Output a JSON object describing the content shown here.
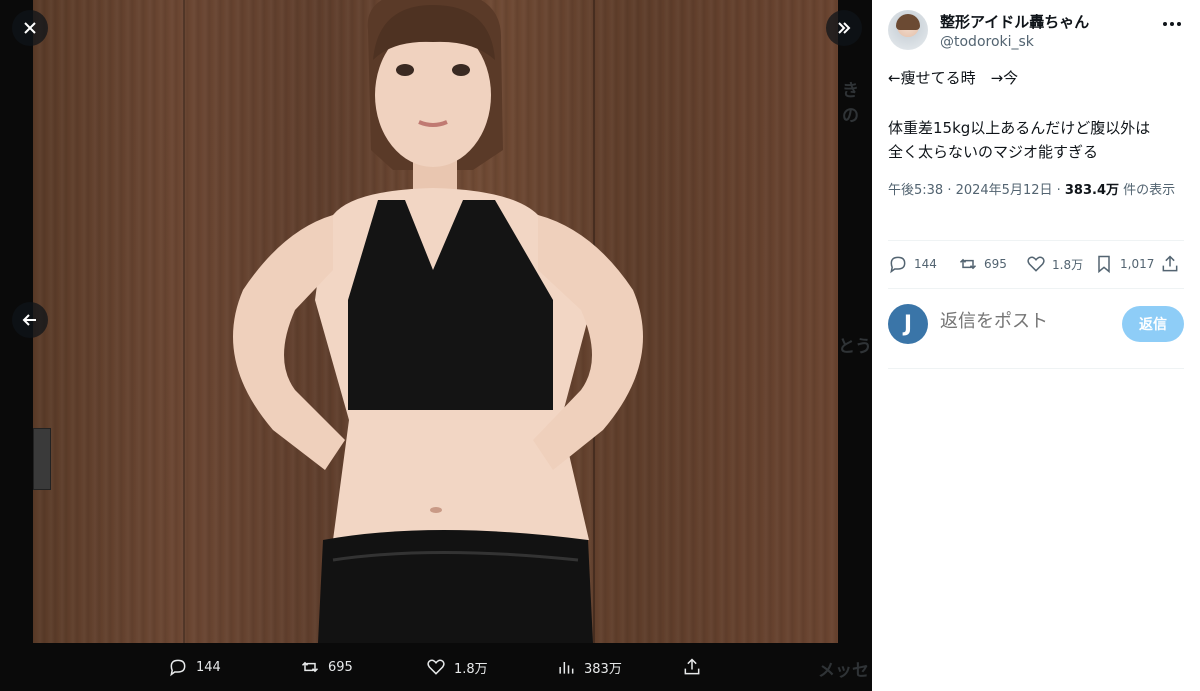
{
  "viewer": {
    "close_label": "✕",
    "next_label": "»",
    "prev_label": "←",
    "actions": {
      "replies": "144",
      "reposts": "695",
      "likes": "1.8万",
      "views": "383万"
    },
    "background_ghost": {
      "a": "きの",
      "b": "とう",
      "c": "メッセ"
    }
  },
  "tweet": {
    "author_name": "整形アイドル轟ちゃん",
    "author_handle": "@todoroki_sk",
    "text_line1": "←痩せてる時　→今",
    "text_line2": "体重差15kg以上あるんだけど腹以外は",
    "text_line3": "全く太らないのマジオ能すぎる",
    "time": "午後5:38 · 2024年5月12日 · ",
    "views": "383.4万",
    "views_suffix": " 件の表示",
    "actions": {
      "replies": "144",
      "reposts": "695",
      "likes": "1.8万",
      "bookmarks": "1,017"
    }
  },
  "reply": {
    "avatar_letter": "J",
    "placeholder": "返信をポスト",
    "button_label": "返信"
  },
  "colors": {
    "accent": "#1d9bf0",
    "reply_button": "#8ecdf7",
    "reply_avatar": "#3a75a8"
  }
}
